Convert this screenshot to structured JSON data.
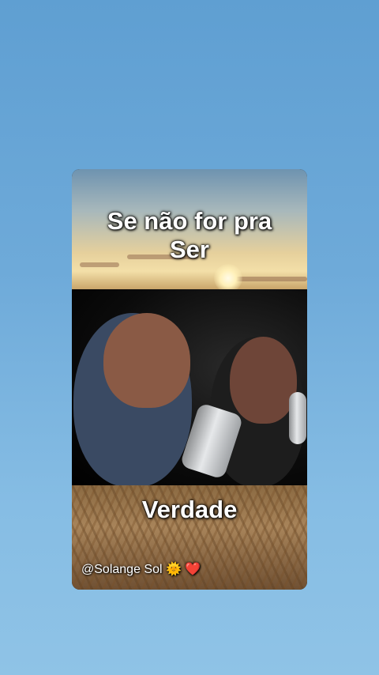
{
  "captions": {
    "line1": "Se não for pra",
    "line2": "Ser",
    "middle": "Verdade"
  },
  "watermark": {
    "handle": "@Solange Sol",
    "emoji_sun": "🌞",
    "emoji_heart": "❤️"
  },
  "colors": {
    "background": "#6eaad9",
    "caption_text": "#ffffff"
  }
}
